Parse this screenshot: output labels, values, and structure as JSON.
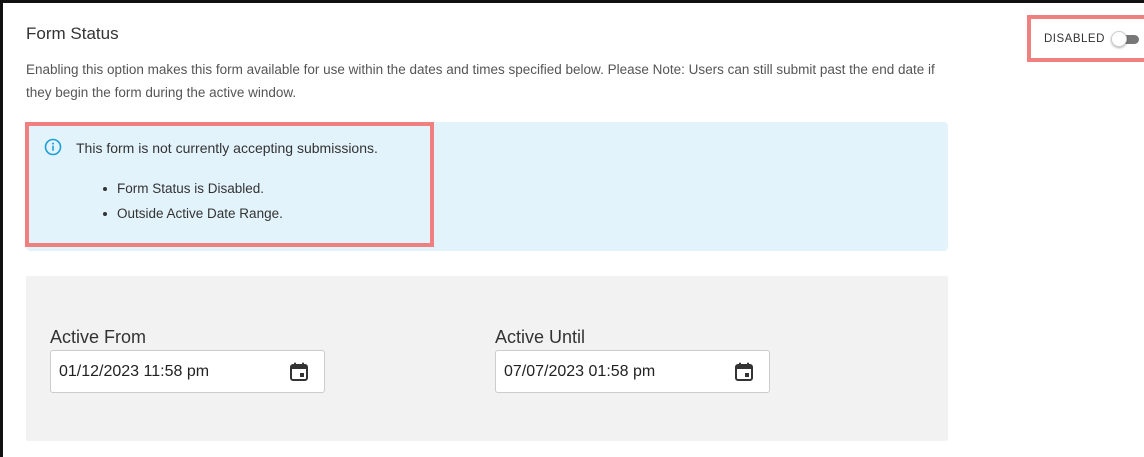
{
  "form_status": {
    "title": "Form Status",
    "description": "Enabling this option makes this form available for use within the dates and times specified below. Please Note: Users can still submit past the end date if they begin the form during the active window.",
    "toggle": {
      "label": "DISABLED",
      "state": "off"
    }
  },
  "alert": {
    "icon": "info-icon",
    "message": "This form is not currently accepting submissions.",
    "reasons": [
      "Form Status is Disabled.",
      "Outside Active Date Range."
    ],
    "background_color": "#e3f3fb",
    "icon_color": "#1a9fdb"
  },
  "dates": {
    "active_from": {
      "label": "Active From",
      "value": "01/12/2023 11:58 pm",
      "icon": "calendar-icon"
    },
    "active_until": {
      "label": "Active Until",
      "value": "07/07/2023 01:58 pm",
      "icon": "calendar-icon"
    }
  },
  "highlight_color": "#f08080"
}
